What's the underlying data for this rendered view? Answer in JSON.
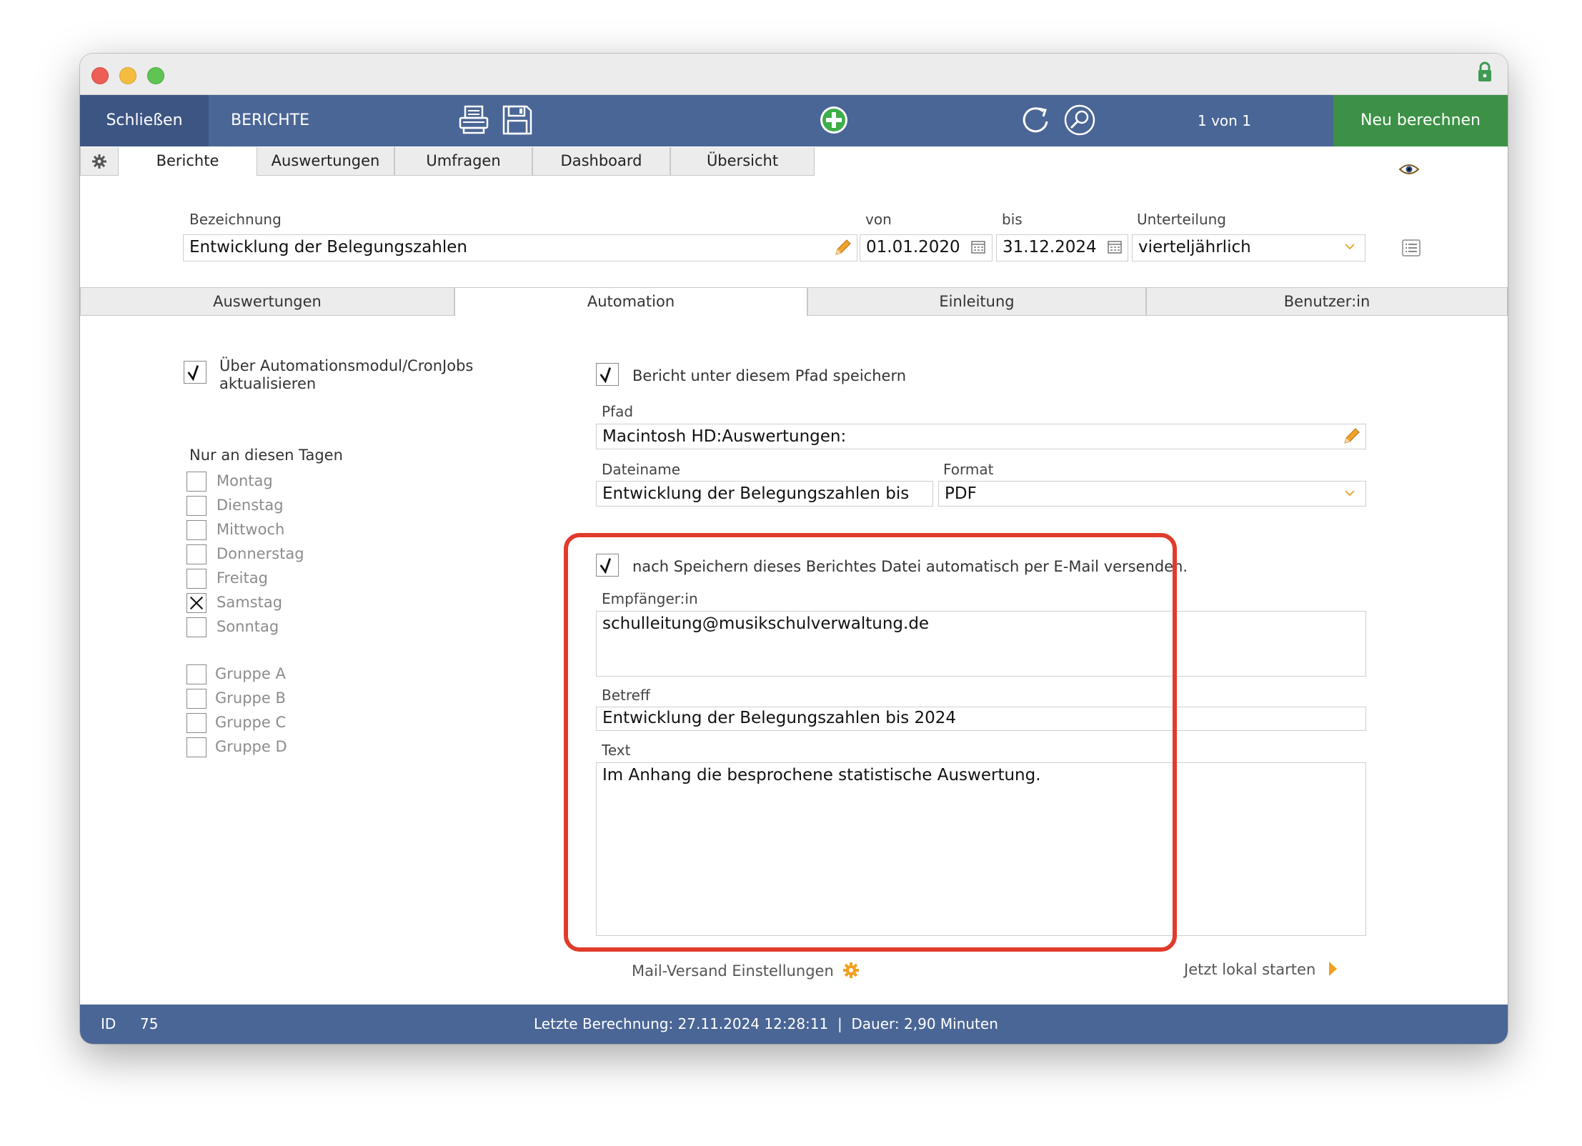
{
  "toolbar": {
    "close_label": "Schließen",
    "section_title": "BERICHTE",
    "record_counter": "1 von 1",
    "recalc_label": "Neu berechnen"
  },
  "main_tabs": [
    "Berichte",
    "Auswertungen",
    "Umfragen",
    "Dashboard",
    "Übersicht"
  ],
  "report": {
    "name_label": "Bezeichnung",
    "name_value": "Entwicklung der Belegungszahlen",
    "from_label": "von",
    "from_value": "01.01.2020",
    "to_label": "bis",
    "to_value": "31.12.2024",
    "division_label": "Unterteilung",
    "division_value": "vierteljährlich"
  },
  "sub_tabs": [
    "Auswertungen",
    "Automation",
    "Einleitung",
    "Benutzer:in"
  ],
  "automation": {
    "cron_label_line1": "Über Automationsmodul/CronJobs",
    "cron_label_line2": "aktualisieren",
    "days_heading": "Nur an diesen Tagen",
    "days": [
      "Montag",
      "Dienstag",
      "Mittwoch",
      "Donnerstag",
      "Freitag",
      "Samstag",
      "Sonntag"
    ],
    "groups": [
      "Gruppe A",
      "Gruppe B",
      "Gruppe C",
      "Gruppe D"
    ],
    "save_path_label": "Bericht unter diesem Pfad speichern",
    "path_label": "Pfad",
    "path_value": "Macintosh HD:Auswertungen:",
    "filename_label": "Dateiname",
    "filename_value": "Entwicklung der Belegungszahlen bis",
    "format_label": "Format",
    "format_value": "PDF",
    "email_label": "nach Speichern dieses Berichtes Datei automatisch per E-Mail versenden.",
    "recipient_label": "Empfänger:in",
    "recipient_value": "schulleitung@musikschulverwaltung.de",
    "subject_label": "Betreff",
    "subject_value": "Entwicklung der Belegungszahlen bis 2024",
    "text_label": "Text",
    "text_value": "Im Anhang die besprochene statistische Auswertung.",
    "mail_settings_link": "Mail-Versand Einstellungen",
    "run_local_link": "Jetzt lokal starten"
  },
  "status": {
    "id_label": "ID",
    "id_value": "75",
    "last_calc": "Letzte Berechnung: 27.11.2024 12:28:11  |  Dauer: 2,90 Minuten"
  },
  "colors": {
    "toolbar_blue": "#4a6696",
    "close_blue": "#3c5583",
    "recalc_green": "#3d9147",
    "highlight_red": "#e03b2b",
    "accent_orange": "#f0a020"
  }
}
